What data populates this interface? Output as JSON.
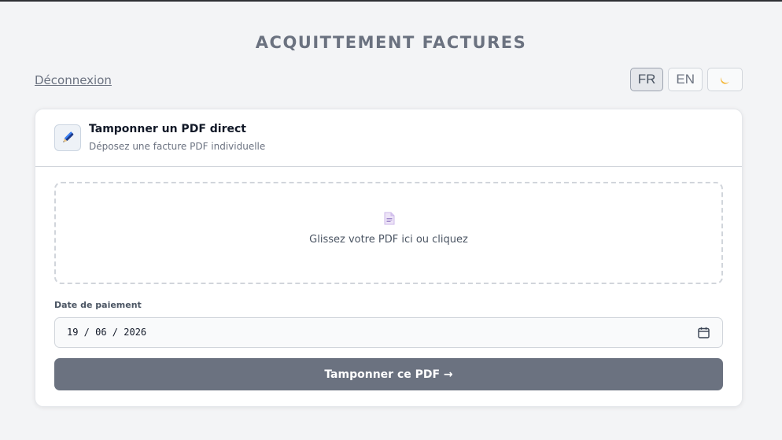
{
  "header": {
    "title": "ACQUITTEMENT FACTURES",
    "logout_label": "Déconnexion"
  },
  "language": {
    "options": [
      "FR",
      "EN"
    ],
    "selected": "FR",
    "theme_toggle_icon": "moon-icon"
  },
  "card": {
    "title": "Tamponner un PDF direct",
    "subtitle": "Déposez une facture PDF individuelle",
    "header_icon": "pen-icon",
    "dropzone": {
      "icon": "document-icon",
      "text": "Glissez votre PDF ici ou cliquez"
    },
    "date_field": {
      "label": "Date de paiement",
      "value": "19 / 06 / 2026",
      "icon": "calendar-icon"
    },
    "submit_label": "Tamponner ce PDF →"
  },
  "colors": {
    "background": "#f3f4f6",
    "button": "#6b7280",
    "title": "#6b7280"
  }
}
